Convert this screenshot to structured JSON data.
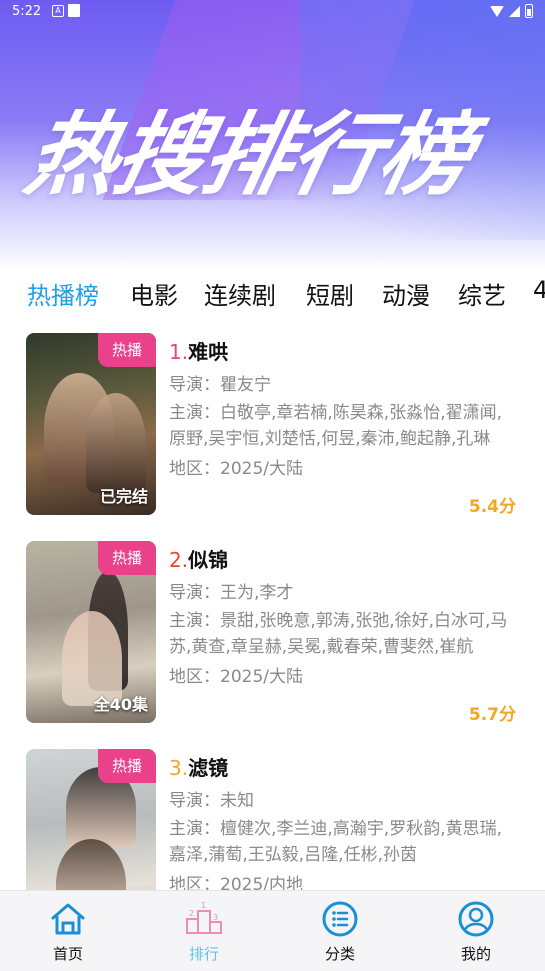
{
  "status_bar": {
    "time": "5:22",
    "notif_letter": "A"
  },
  "banner": {
    "title": "热搜排行榜"
  },
  "tabs": [
    {
      "label": "热播榜",
      "active": true
    },
    {
      "label": "电影"
    },
    {
      "label": "连续剧"
    },
    {
      "label": "短剧"
    },
    {
      "label": "动漫"
    },
    {
      "label": "综艺"
    },
    {
      "label": "4"
    }
  ],
  "items": [
    {
      "rank": "1.",
      "rank_color": "#e9428a",
      "title": "难哄",
      "badge": "热播",
      "poster_caption": "已完结",
      "director": "导演：瞿友宁",
      "cast": "主演：白敬亭,章若楠,陈昊森,张淼怡,翟潇闻,原野,吴宇恒,刘楚恬,何昱,秦沛,鲍起静,孔琳",
      "region": "地区：2025/大陆",
      "score": "5.4分"
    },
    {
      "rank": "2.",
      "rank_color": "#e8482c",
      "title": "似锦",
      "badge": "热播",
      "poster_caption": "全40集",
      "director": "导演：王为,李才",
      "cast": "主演：景甜,张晚意,郭涛,张弛,徐好,白冰可,马苏,黄查,章呈赫,吴冕,戴春荣,曹斐然,崔航",
      "region": "地区：2025/大陆",
      "score": "5.7分"
    },
    {
      "rank": "3.",
      "rank_color": "#f5a623",
      "title": "滤镜",
      "badge": "热播",
      "poster_caption": "",
      "director": "导演：未知",
      "cast": "主演：檀健次,李兰迪,高瀚宇,罗秋韵,黄思瑞,嘉泽,蒲萄,王弘毅,吕隆,任彬,孙茵",
      "region": "地区：2025/内地",
      "score": ""
    }
  ],
  "bottom_nav": [
    {
      "label": "首页",
      "icon": "home-icon"
    },
    {
      "label": "排行",
      "icon": "ranking-icon",
      "active": true
    },
    {
      "label": "分类",
      "icon": "category-icon"
    },
    {
      "label": "我的",
      "icon": "profile-icon"
    }
  ],
  "colors": {
    "accent": "#1da1e6",
    "badge": "#e9428a",
    "score": "#f5a623",
    "nav_active": "#5ec3ea"
  }
}
